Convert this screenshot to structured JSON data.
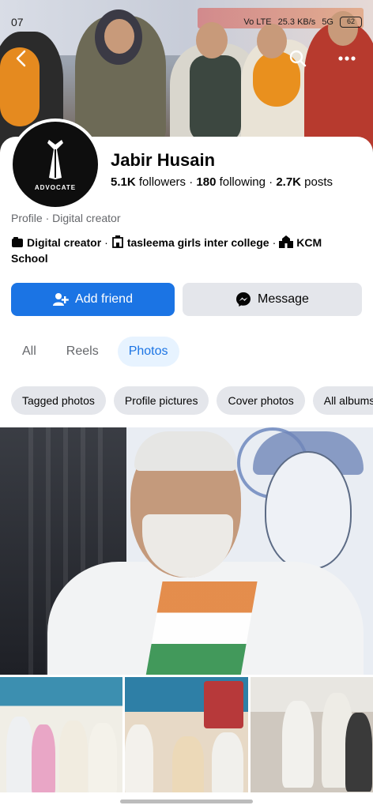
{
  "status_bar": {
    "time": "07",
    "network": "Vo LTE",
    "speed": "25.3 KB/s",
    "signal": "5G",
    "battery": "62"
  },
  "profile": {
    "name": "Jabir Husain",
    "avatar_text": "ADVOCATE",
    "stats": {
      "followers_count": "5.1K",
      "followers_label": "followers",
      "following_count": "180",
      "following_label": "following",
      "posts_count": "2.7K",
      "posts_label": "posts"
    },
    "category_line": "Profile · Digital creator",
    "details": {
      "item1": "Digital creator",
      "item2": "tasleema girls inter college",
      "item3": "KCM School"
    }
  },
  "actions": {
    "add_friend": "Add friend",
    "message": "Message"
  },
  "tabs": [
    "All",
    "Reels",
    "Photos"
  ],
  "active_tab": "Photos",
  "chips": [
    "Tagged photos",
    "Profile pictures",
    "Cover photos",
    "All albums"
  ],
  "colors": {
    "accent": "#1b74e4",
    "secondary_btn": "#e4e6eb",
    "active_tab_bg": "#e7f3ff"
  }
}
